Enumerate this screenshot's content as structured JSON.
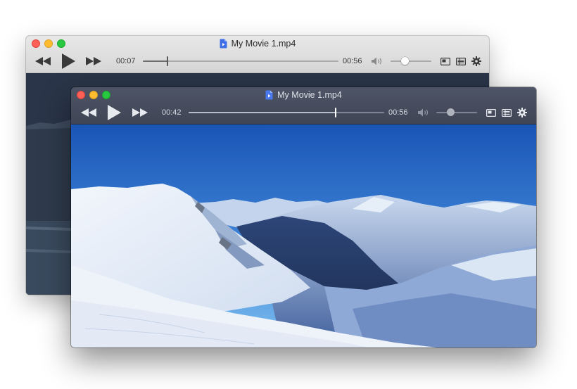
{
  "back_window": {
    "title": "My Movie 1.mp4",
    "current_time": "00:07",
    "duration": "00:56",
    "progress_fraction": 0.125,
    "volume_fraction": 0.35
  },
  "front_window": {
    "title": "My Movie 1.mp4",
    "current_time": "00:42",
    "duration": "00:56",
    "progress_fraction": 0.75,
    "volume_fraction": 0.35
  },
  "icons": {
    "traffic_lights": [
      "close-button",
      "minimize-button",
      "zoom-button"
    ],
    "controls": [
      "rewind-icon",
      "play-icon",
      "fast-forward-icon",
      "volume-icon",
      "picture-in-picture-icon",
      "playlist-icon",
      "gear-icon"
    ],
    "file": "video-file-icon"
  },
  "colors": {
    "close": "#fe5f57",
    "minimize": "#febc2e",
    "zoom": "#28c840",
    "sky_top": "#1a55b6",
    "sky_bottom": "#5ea6ec"
  }
}
